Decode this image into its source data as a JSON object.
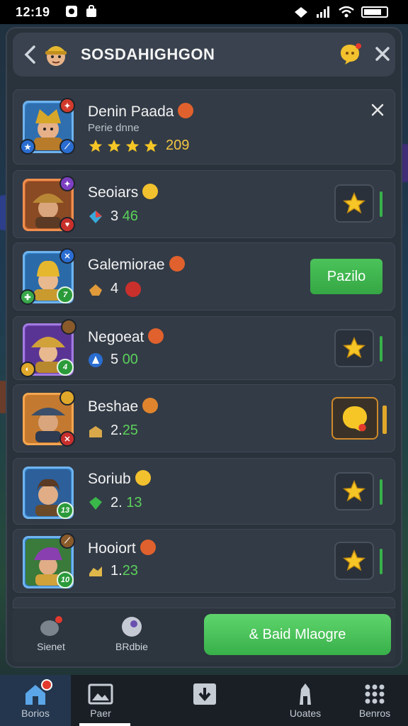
{
  "status_bar": {
    "time": "12:19",
    "battery_text": ""
  },
  "header": {
    "title": "SOSDAHIGHGON"
  },
  "rows": [
    {
      "name": "Denin Paada",
      "subtitle": "Perie dnne",
      "stat": "209",
      "stars": 4,
      "action": "close"
    },
    {
      "name": "Seoiars",
      "stat_prefix": "3",
      "stat_value": "46",
      "action": "star"
    },
    {
      "name": "Galemiorae",
      "stat_prefix": "4",
      "stat_value": "",
      "action": "button",
      "button_label": "Pazilo"
    },
    {
      "name": "Negoeat",
      "stat_prefix": "5",
      "stat_value": "00",
      "action": "star"
    },
    {
      "name": "Beshae",
      "stat_prefix": "2.",
      "stat_value": "25",
      "action": "chat"
    },
    {
      "name": "Soriub",
      "stat_prefix": "2.",
      "stat_value": "13",
      "action": "star"
    },
    {
      "name": "Hooiort",
      "stat_prefix": "1.",
      "stat_value": "23",
      "action": "star"
    }
  ],
  "row_levels": [
    "",
    "",
    "7",
    "4",
    "",
    "13",
    "10"
  ],
  "bottom_panel": {
    "left_label": "Sienet",
    "middle_label": "BRdbie",
    "primary_button": "& Baid Mlaogre"
  },
  "nav": [
    {
      "label": "Borios",
      "icon": "home-icon"
    },
    {
      "label": "Paer",
      "icon": "image-icon"
    },
    {
      "label": "",
      "icon": "download-icon"
    },
    {
      "label": "Uoates",
      "icon": "tower-icon"
    },
    {
      "label": "Benros",
      "icon": "grid-icon"
    }
  ],
  "colors": {
    "accent_green": "#38b04a",
    "panel": "#2a323c",
    "row": "#333b46"
  }
}
